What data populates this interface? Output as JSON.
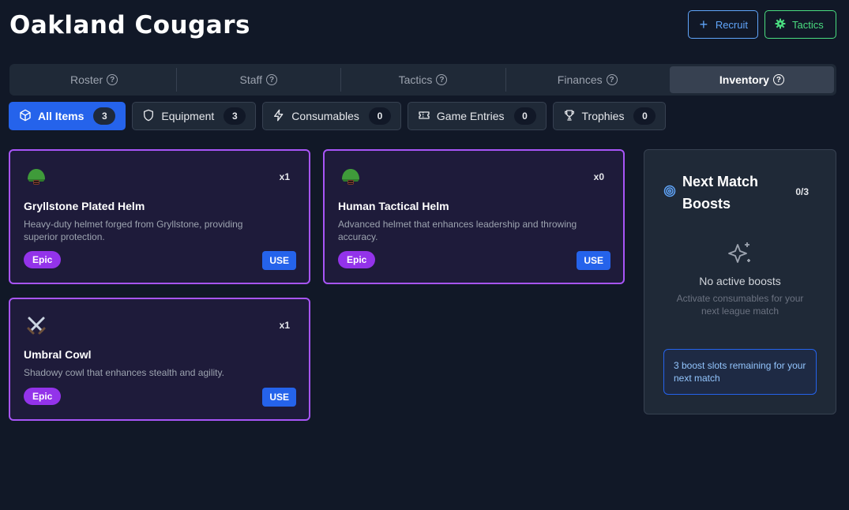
{
  "header": {
    "team_name": "Oakland Cougars",
    "recruit_label": "Recruit",
    "tactics_label": "Tactics"
  },
  "tabs": [
    {
      "label": "Roster",
      "active": false
    },
    {
      "label": "Staff",
      "active": false
    },
    {
      "label": "Tactics",
      "active": false
    },
    {
      "label": "Finances",
      "active": false
    },
    {
      "label": "Inventory",
      "active": true
    }
  ],
  "filters": [
    {
      "label": "All Items",
      "count": "3",
      "icon": "box-icon",
      "active": true
    },
    {
      "label": "Equipment",
      "count": "3",
      "icon": "shield-icon",
      "active": false
    },
    {
      "label": "Consumables",
      "count": "0",
      "icon": "lightning-icon",
      "active": false
    },
    {
      "label": "Game Entries",
      "count": "0",
      "icon": "ticket-icon",
      "active": false
    },
    {
      "label": "Trophies",
      "count": "0",
      "icon": "trophy-icon",
      "active": false
    }
  ],
  "items": [
    {
      "icon": "helmet-icon",
      "name": "Gryllstone Plated Helm",
      "qty": "x1",
      "description": "Heavy-duty helmet forged from Gryllstone, providing superior protection.",
      "rarity": "Epic",
      "action": "USE"
    },
    {
      "icon": "helmet-icon",
      "name": "Human Tactical Helm",
      "qty": "x0",
      "description": "Advanced helmet that enhances leadership and throwing accuracy.",
      "rarity": "Epic",
      "action": "USE"
    },
    {
      "icon": "crossed-swords-icon",
      "name": "Umbral Cowl",
      "qty": "x1",
      "description": "Shadowy cowl that enhances stealth and agility.",
      "rarity": "Epic",
      "action": "USE"
    }
  ],
  "boosts": {
    "title": "Next Match Boosts",
    "slots": "0/3",
    "empty_title": "No active boosts",
    "empty_subtitle": "Activate consumables for your next league match",
    "note": "3 boost slots remaining for your next match"
  },
  "colors": {
    "background": "#111827",
    "accent_blue": "#2563eb",
    "epic_purple": "#a855f7",
    "recruit_blue": "#60a5fa",
    "tactics_green": "#4ade80"
  }
}
